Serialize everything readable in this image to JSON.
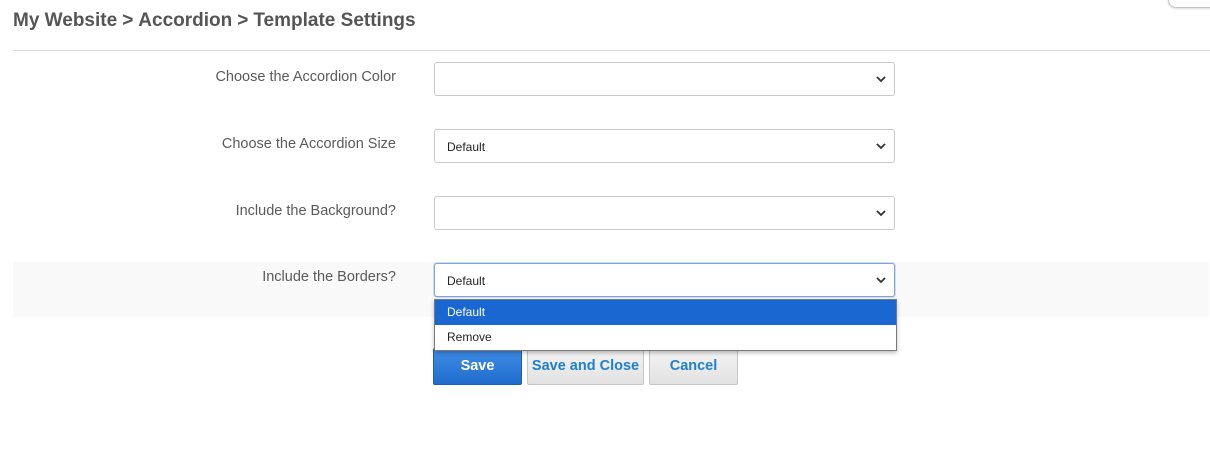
{
  "breadcrumb": {
    "items": [
      "My Website",
      "Accordion",
      "Template Settings"
    ],
    "separator": ">"
  },
  "fields": [
    {
      "label": "Choose the Accordion Color",
      "value": ""
    },
    {
      "label": "Choose the Accordion Size",
      "value": "Default"
    },
    {
      "label": "Include the Background?",
      "value": ""
    },
    {
      "label": "Include the Borders?",
      "value": "Default"
    }
  ],
  "dropdown": {
    "open_field": "Include the Borders?",
    "options": [
      "Default",
      "Remove"
    ],
    "highlighted": "Default"
  },
  "buttons": {
    "save": "Save",
    "save_and_close": "Save and Close",
    "cancel": "Cancel"
  },
  "colors": {
    "primary": "#1f6ccd",
    "link": "#1d80c8",
    "highlight": "#1a67d2",
    "text": "#555555"
  },
  "icons": {
    "select_arrow": "chevron-down-icon"
  }
}
